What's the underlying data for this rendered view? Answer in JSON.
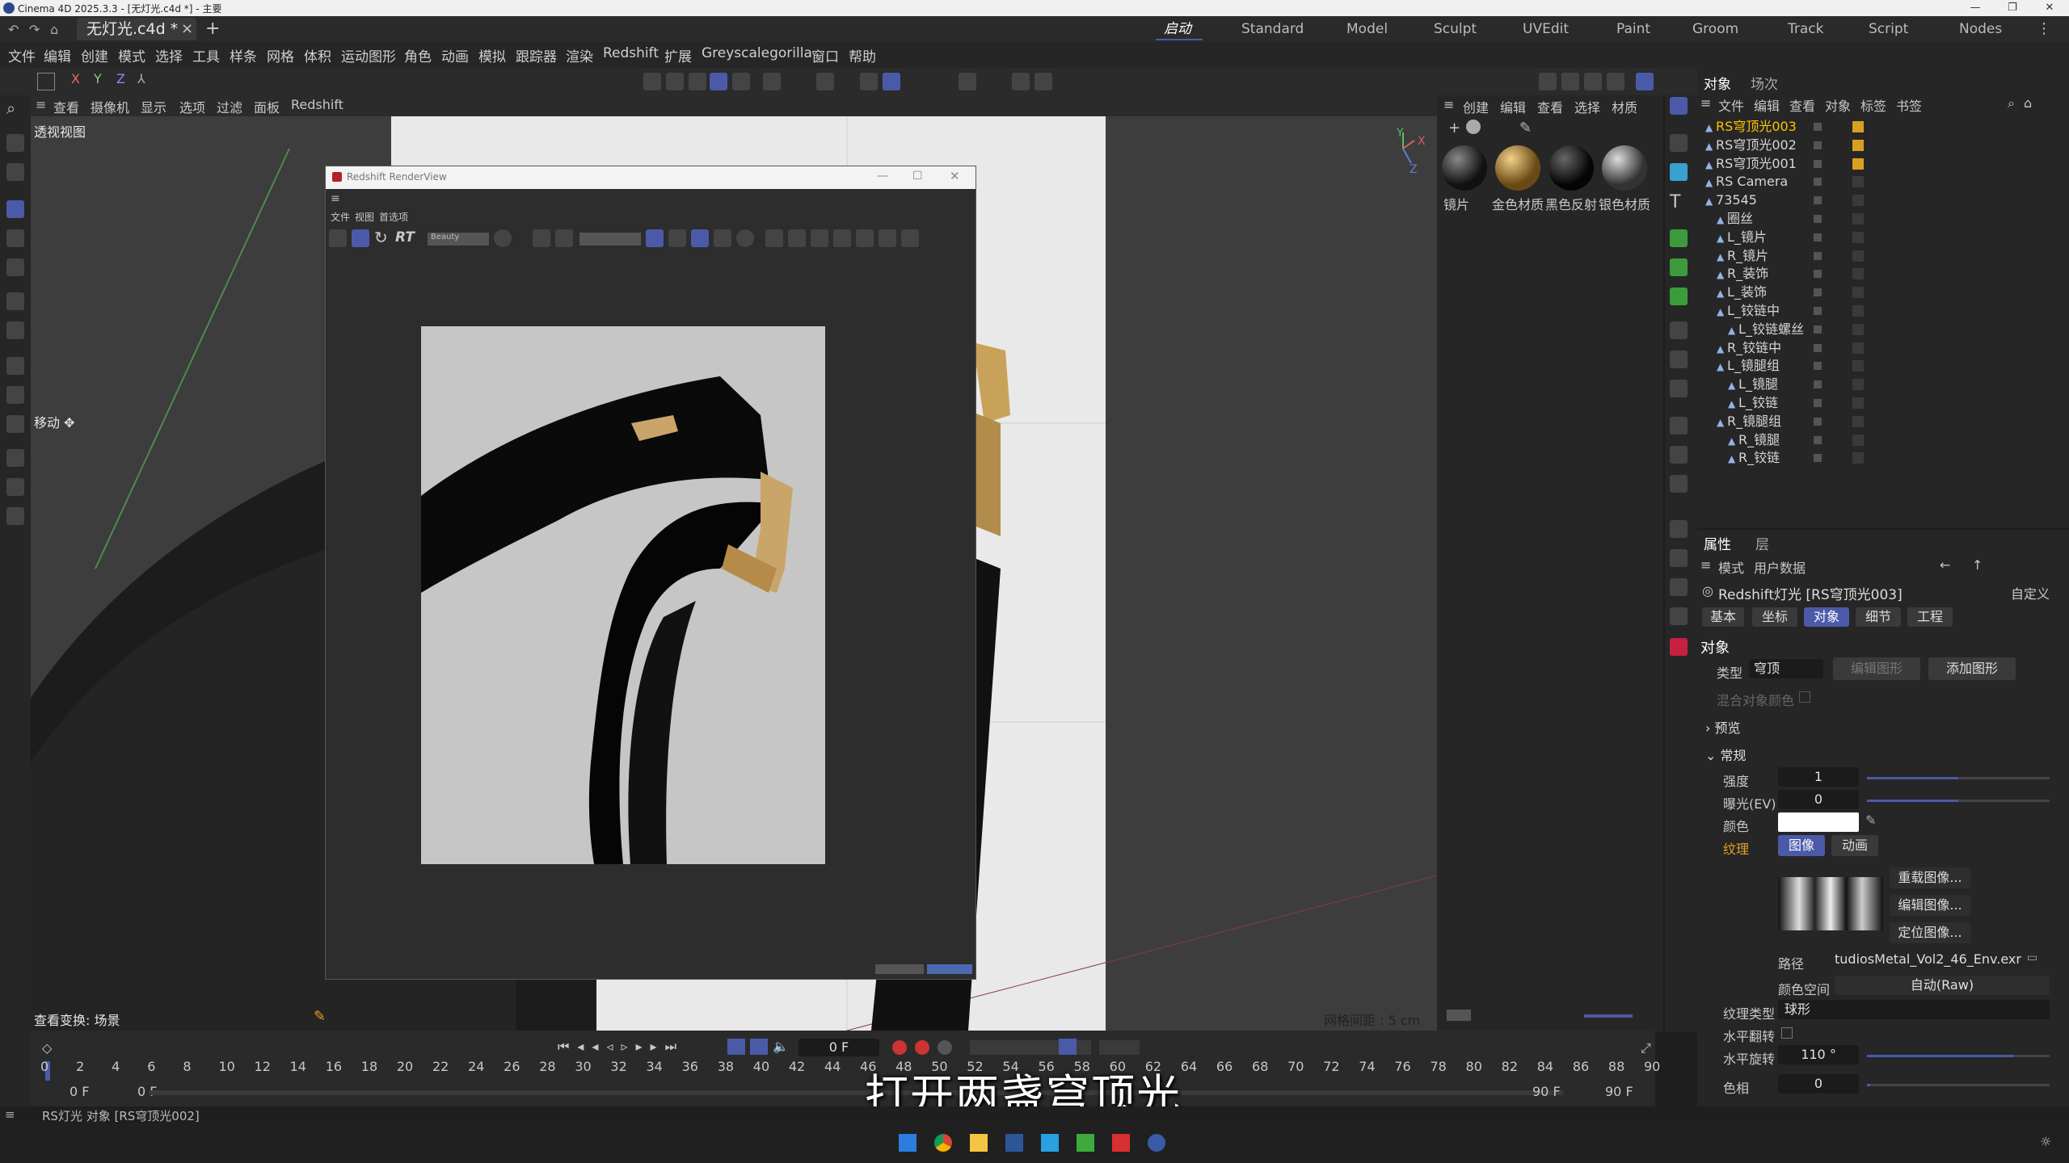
{
  "window": {
    "title": "Cinema 4D 2025.3.3 - [无灯光.c4d *] - 主要",
    "min": "—",
    "max": "❐",
    "close": "✕"
  },
  "tabs": {
    "doc": "无灯光.c4d *",
    "close": "×",
    "add": "+"
  },
  "layouts": [
    "启动",
    "Standard",
    "Model",
    "Sculpt",
    "UVEdit",
    "Paint",
    "Groom",
    "Track",
    "Script",
    "Nodes"
  ],
  "menu": [
    "文件",
    "编辑",
    "创建",
    "模式",
    "选择",
    "工具",
    "样条",
    "网格",
    "体积",
    "运动图形",
    "角色",
    "动画",
    "模拟",
    "跟踪器",
    "渲染",
    "Redshift",
    "扩展",
    "Greyscalegorilla",
    "窗口",
    "帮助"
  ],
  "axis_buttons": [
    "X",
    "Y",
    "Z"
  ],
  "viewport": {
    "menu": [
      "查看",
      "摄像机",
      "显示",
      "选项",
      "过滤",
      "面板",
      "Redshift"
    ],
    "label": "透视视图",
    "move_label": "移动",
    "bottom_left": "查看变换: 场景",
    "grid_spacing": "网格间距 : 5 cm"
  },
  "renderview": {
    "title": "Redshift RenderView",
    "menu": [
      "文件",
      "视图",
      "首选项"
    ],
    "rt": "RT",
    "aov": "Beauty"
  },
  "material_panel": {
    "menu": [
      "创建",
      "编辑",
      "查看",
      "选择",
      "材质"
    ],
    "materials": [
      "镜片",
      "金色材质",
      "黑色反射",
      "银色材质"
    ]
  },
  "object_manager": {
    "tabs": [
      "对象",
      "场次"
    ],
    "menu": [
      "文件",
      "编辑",
      "查看",
      "对象",
      "标签",
      "书签"
    ],
    "objects": [
      {
        "name": "RS穹顶光003",
        "highlight": true
      },
      {
        "name": "RS穹顶光002",
        "highlight": false
      },
      {
        "name": "RS穹顶光001",
        "highlight": false
      },
      {
        "name": "RS Camera",
        "highlight": false
      },
      {
        "name": "73545",
        "highlight": false
      },
      {
        "name": "圈丝",
        "highlight": false
      },
      {
        "name": "L_镜片",
        "highlight": false
      },
      {
        "name": "R_镜片",
        "highlight": false
      },
      {
        "name": "R_装饰",
        "highlight": false
      },
      {
        "name": "L_装饰",
        "highlight": false
      },
      {
        "name": "L_铰链中",
        "highlight": false
      },
      {
        "name": "L_铰链螺丝",
        "highlight": false
      },
      {
        "name": "R_铰链中",
        "highlight": false
      },
      {
        "name": "L_镜腿组",
        "highlight": false
      },
      {
        "name": "L_镜腿",
        "highlight": false
      },
      {
        "name": "L_铰链",
        "highlight": false
      },
      {
        "name": "R_镜腿组",
        "highlight": false
      },
      {
        "name": "R_镜腿",
        "highlight": false
      },
      {
        "name": "R_铰链",
        "highlight": false
      }
    ]
  },
  "attributes": {
    "tabs": [
      "属性",
      "层"
    ],
    "menu": [
      "模式",
      "用户数据"
    ],
    "object_title": "Redshift灯光 [RS穹顶光003]",
    "custom": "自定义",
    "subtabs": [
      "基本",
      "坐标",
      "对象",
      "细节",
      "工程"
    ],
    "section": "对象",
    "type_label": "类型",
    "type_value": "穹顶",
    "edit_shape": "编辑图形",
    "add_shape": "添加图形",
    "mix_color": "混合对象颜色",
    "preview": "预览",
    "general": "常规",
    "intensity_label": "强度",
    "intensity": "1",
    "exposure_label": "曝光(EV)",
    "exposure": "0",
    "color_label": "颜色",
    "texture_label": "纹理",
    "tex_tabs": [
      "图像",
      "动画"
    ],
    "tex_buttons": [
      "重载图像...",
      "编辑图像...",
      "定位图像..."
    ],
    "path_label": "路径",
    "path": "tudiosMetal_Vol2_46_Env.exr",
    "colorspace_label": "颜色空间",
    "colorspace": "自动(Raw)",
    "textype_label": "纹理类型",
    "textype": "球形",
    "hflip_label": "水平翻转",
    "hrot_label": "水平旋转",
    "hrot": "110 °",
    "hue_label": "色相",
    "hue": "0",
    "intensity_fraction": 0.5,
    "exposure_fraction": 0.5,
    "hrot_fraction": 0.8
  },
  "timeline": {
    "frame": "0 F",
    "ticks": [
      "0",
      "2",
      "4",
      "6",
      "8",
      "10",
      "12",
      "14",
      "16",
      "18",
      "20",
      "22",
      "24",
      "26",
      "28",
      "30",
      "32",
      "34",
      "36",
      "38",
      "40",
      "42",
      "44",
      "46",
      "48",
      "50",
      "52",
      "54",
      "56",
      "58",
      "60",
      "62",
      "64",
      "66",
      "68",
      "70",
      "72",
      "74",
      "76",
      "78",
      "80",
      "82",
      "84",
      "86",
      "88",
      "90"
    ],
    "start1": "0 F",
    "start2": "0 F",
    "end1": "90 F",
    "end2": "90 F"
  },
  "status": "RS灯光 对象 [RS穹顶光002]",
  "subtitle": "打开两盏穹顶光",
  "colors": {
    "accent": "#4b5aa8",
    "highlight_text": "#ffc400",
    "bg": "#1e1e1e"
  }
}
